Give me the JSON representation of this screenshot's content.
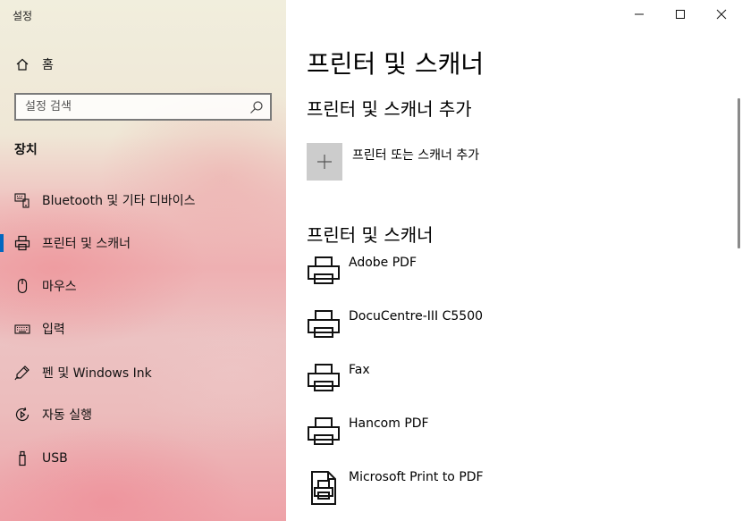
{
  "window": {
    "app_title": "설정",
    "minimize_glyph": "—",
    "maximize_glyph": "☐",
    "close_glyph": "✕"
  },
  "sidebar": {
    "home_label": "홈",
    "search_placeholder": "설정 검색",
    "section_title": "장치",
    "items": [
      {
        "label": "Bluetooth 및 기타 디바이스",
        "icon": "bluetooth-devices-icon"
      },
      {
        "label": "프린터 및 스캐너",
        "icon": "printer-icon",
        "selected": true
      },
      {
        "label": "마우스",
        "icon": "mouse-icon"
      },
      {
        "label": "입력",
        "icon": "keyboard-icon"
      },
      {
        "label": "펜 및 Windows Ink",
        "icon": "pen-icon"
      },
      {
        "label": "자동 실행",
        "icon": "autoplay-icon"
      },
      {
        "label": "USB",
        "icon": "usb-icon"
      }
    ],
    "accent_color": "#0067c0"
  },
  "main": {
    "page_title": "프린터 및 스캐너",
    "add_section_title": "프린터 및 스캐너 추가",
    "add_button_label": "프린터 또는 스캐너 추가",
    "list_section_title": "프린터 및 스캐너",
    "printers": [
      {
        "name": "Adobe PDF",
        "icon": "printer-icon"
      },
      {
        "name": "DocuCentre-III C5500",
        "icon": "printer-icon"
      },
      {
        "name": "Fax",
        "icon": "printer-icon"
      },
      {
        "name": "Hancom PDF",
        "icon": "printer-icon"
      },
      {
        "name": "Microsoft Print to PDF",
        "icon": "pdf-printer-icon"
      }
    ]
  }
}
